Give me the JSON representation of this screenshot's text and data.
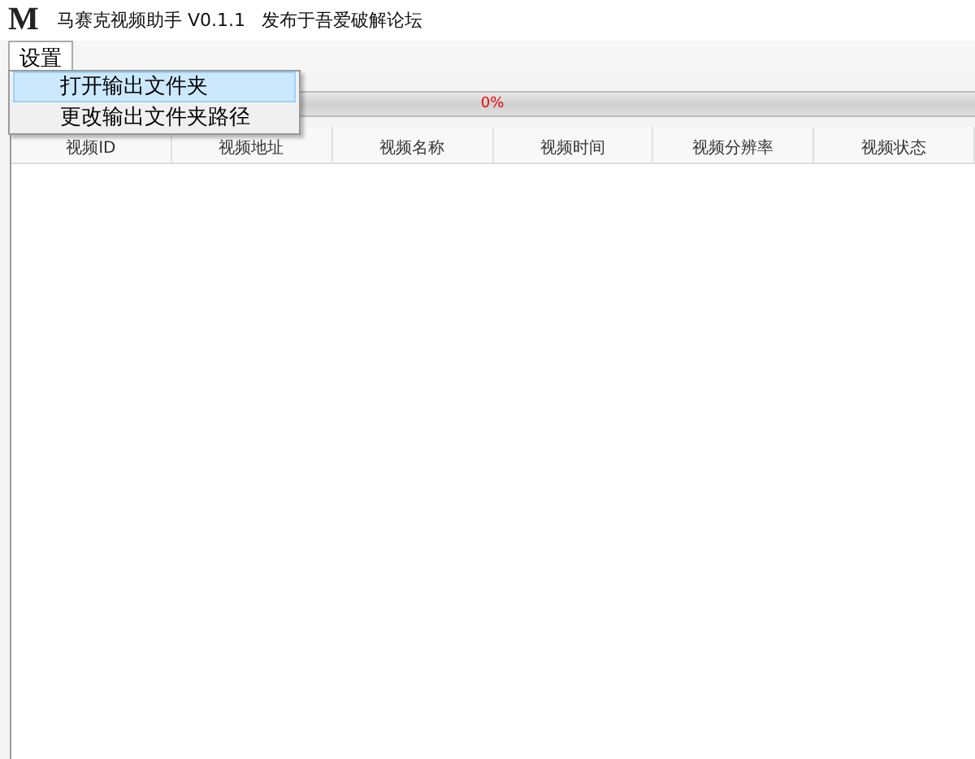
{
  "window": {
    "logo": "M",
    "title": "马赛克视频助手 V0.1.1",
    "subtitle": "发布于吾爱破解论坛"
  },
  "menu_bar": [
    {
      "label": "设置",
      "selected": true
    }
  ],
  "menu": {
    "items": [
      {
        "label": "打开输出文件夹",
        "selected": true
      },
      {
        "label": "更改输出文件夹路径",
        "selected": false
      }
    ]
  },
  "progress": {
    "level": 0,
    "label": "0%"
  },
  "table": {
    "columns": [
      "视频ID",
      "视频地址",
      "视频名称",
      "视频时间",
      "视频分辨率",
      "视频状态"
    ]
  }
}
